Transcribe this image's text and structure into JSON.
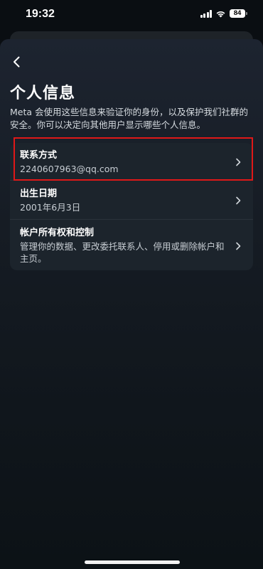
{
  "status_bar": {
    "time": "19:32",
    "battery": "84"
  },
  "header": {
    "back_icon": "chevron-left-icon",
    "title": "个人信息",
    "description": "Meta 会使用这些信息来验证你的身份，以及保护我们社群的安全。你可以决定向其他用户显示哪些个人信息。"
  },
  "items": [
    {
      "title": "联系方式",
      "subtitle": "2240607963@qq.com",
      "icon": "chevron-right-icon"
    },
    {
      "title": "出生日期",
      "subtitle": "2001年6月3日",
      "icon": "chevron-right-icon"
    },
    {
      "title": "帐户所有权和控制",
      "subtitle": "管理你的数据、更改委托联系人、停用或删除帐户和主页。",
      "icon": "chevron-right-icon"
    }
  ],
  "colors": {
    "highlight": "#e01818",
    "card": "#1c242c"
  }
}
